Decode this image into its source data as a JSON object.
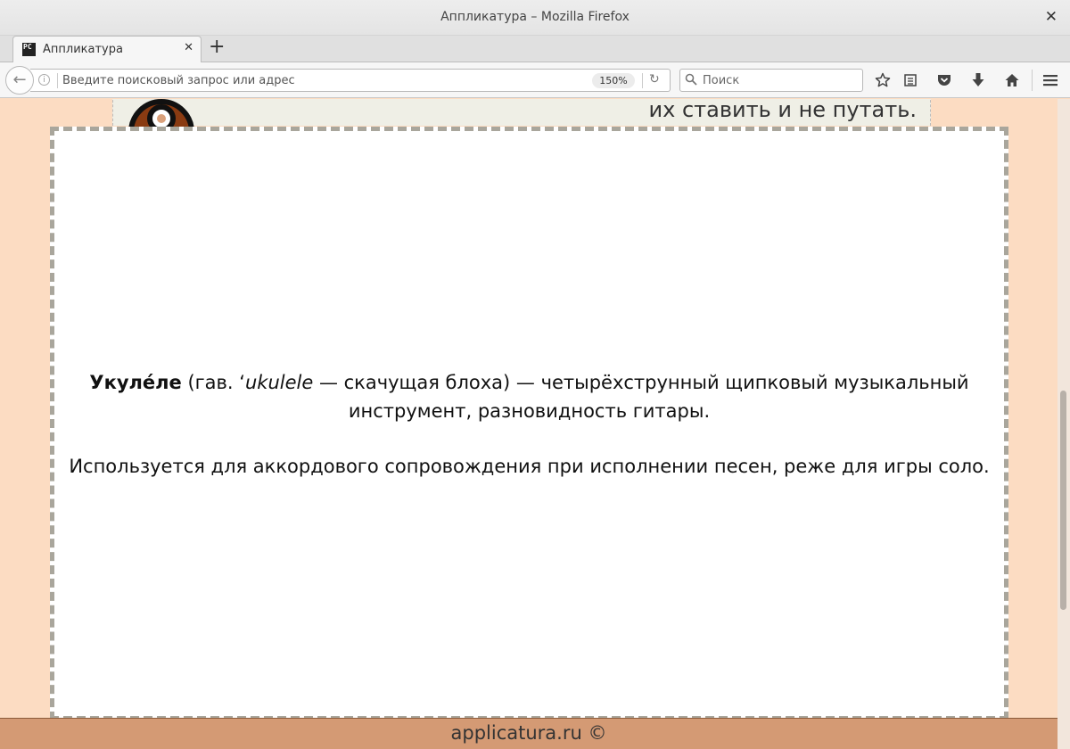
{
  "window": {
    "title": "Аппликатура – Mozilla Firefox",
    "close_glyph": "✕"
  },
  "tabs": [
    {
      "title": "Аппликатура",
      "favicon_text": "PC",
      "close_glyph": "✕"
    }
  ],
  "new_tab_glyph": "+",
  "navbar": {
    "url_placeholder": "Введите поисковый запрос или адрес",
    "zoom_level": "150%",
    "search_placeholder": "Поиск",
    "icons": [
      "back-arrow-icon",
      "info-icon",
      "reload-icon",
      "search-icon",
      "bookmark-star-icon",
      "reading-list-icon",
      "pocket-icon",
      "download-icon",
      "home-icon",
      "menu-icon"
    ]
  },
  "page": {
    "banner_text": "их ставить и не путать.",
    "intro": {
      "term": "Укуле́ле",
      "pre_origin": " (гав. ʻ",
      "origin": "ukulele",
      "definition": " — скачущая блоха) — четырёхструнный щипковый музыкальный инструмент, разновидность гитары."
    },
    "usage": "Используется для аккордового сопровождения при исполнении песен, реже для игры соло.",
    "footer": "applicatura.ru ©"
  },
  "colors": {
    "page_background": "#fcdcc2",
    "footer_background": "#d49a74",
    "card_border": "#a9a69c",
    "banner_background": "#efefe6"
  }
}
